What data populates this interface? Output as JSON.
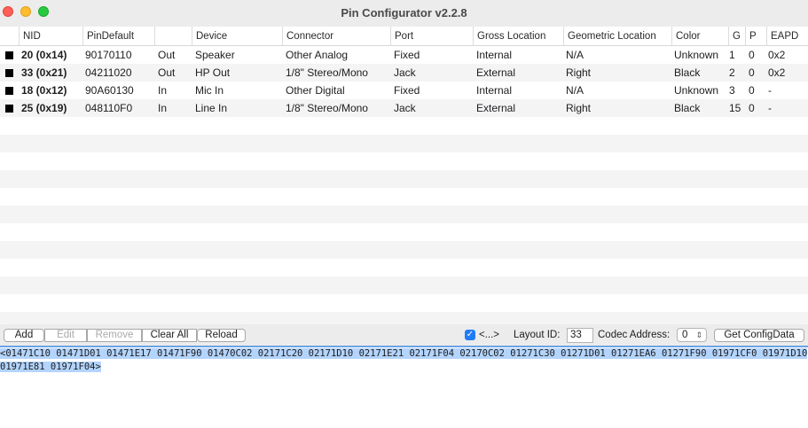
{
  "window": {
    "title": "Pin Configurator v2.2.8"
  },
  "table": {
    "headers": {
      "nid": "NID",
      "pindefault": "PinDefault",
      "direction": "",
      "device": "Device",
      "connector": "Connector",
      "port": "Port",
      "gross": "Gross Location",
      "geometric": "Geometric Location",
      "color": "Color",
      "g": "G",
      "p": "P",
      "eapd": "EAPD"
    },
    "rows": [
      {
        "nid": "20 (0x14)",
        "pindefault": "90170110",
        "direction": "Out",
        "device": "Speaker",
        "connector": "Other Analog",
        "port": "Fixed",
        "gross": "Internal",
        "geometric": "N/A",
        "color": "Unknown",
        "g": "1",
        "p": "0",
        "eapd": "0x2"
      },
      {
        "nid": "33 (0x21)",
        "pindefault": "04211020",
        "direction": "Out",
        "device": "HP Out",
        "connector": "1/8\" Stereo/Mono",
        "port": "Jack",
        "gross": "External",
        "geometric": "Right",
        "color": "Black",
        "g": "2",
        "p": "0",
        "eapd": "0x2"
      },
      {
        "nid": "18 (0x12)",
        "pindefault": "90A60130",
        "direction": "In",
        "device": "Mic In",
        "connector": "Other Digital",
        "port": "Fixed",
        "gross": "Internal",
        "geometric": "N/A",
        "color": "Unknown",
        "g": "3",
        "p": "0",
        "eapd": "-"
      },
      {
        "nid": "25 (0x19)",
        "pindefault": "048110F0",
        "direction": "In",
        "device": "Line In",
        "connector": "1/8\" Stereo/Mono",
        "port": "Jack",
        "gross": "External",
        "geometric": "Right",
        "color": "Black",
        "g": "15",
        "p": "0",
        "eapd": "-"
      }
    ]
  },
  "toolbar": {
    "add": "Add",
    "edit": "Edit",
    "remove": "Remove",
    "clear_all": "Clear All",
    "reload": "Reload",
    "checkbox_label": "<...>",
    "checkbox_checked": true,
    "layout_id_label": "Layout ID:",
    "layout_id_value": "33",
    "codec_address_label": "Codec Address:",
    "codec_address_value": "0",
    "get_config": "Get ConfigData"
  },
  "config_data": {
    "line1": "<01471C10 01471D01 01471E17 01471F90 01470C02 02171C20 02171D10 02171E21 02171F04 02170C02 01271C30 01271D01 01271EA6 01271F90 01971CF0 01971D10",
    "line2": "01971E81 01971F04>"
  },
  "colors": {
    "accent": "#1f7cf6",
    "selection": "#b3d4fd",
    "row_alt": "#f4f4f5"
  }
}
